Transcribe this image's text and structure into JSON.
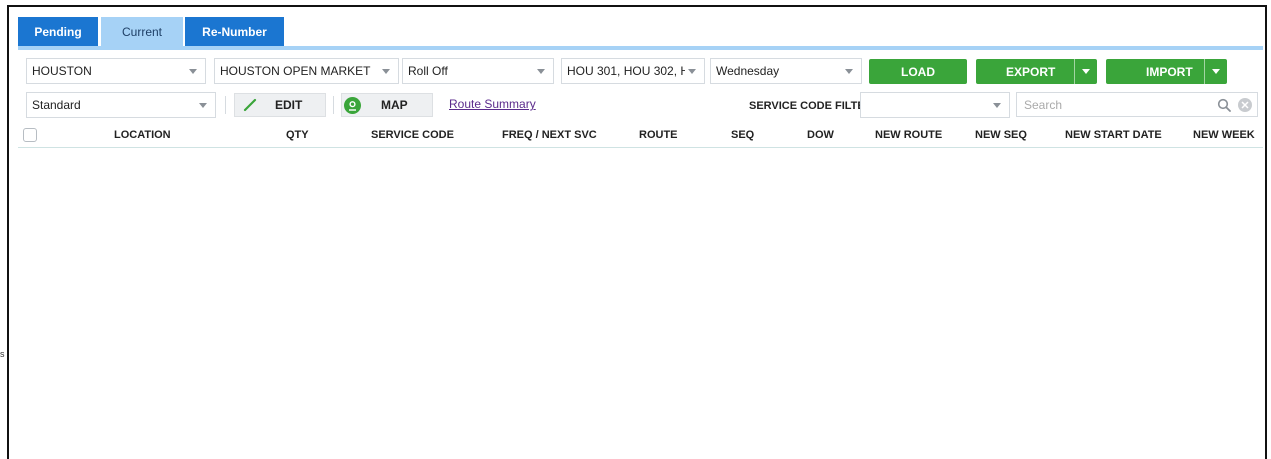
{
  "tabs": [
    {
      "label": "Pending",
      "active": false
    },
    {
      "label": "Current",
      "active": true
    },
    {
      "label": "Re-Number",
      "active": false
    }
  ],
  "filters": {
    "region": "HOUSTON",
    "market": "HOUSTON OPEN MARKET",
    "service_type": "Roll Off",
    "routes": "HOU 301, HOU 302, H",
    "day": "Wednesday"
  },
  "actions": {
    "load_label": "LOAD",
    "export_label": "EXPORT",
    "import_label": "IMPORT"
  },
  "toolbar": {
    "view_mode": "Standard",
    "edit_label": "EDIT",
    "map_label": "MAP",
    "route_summary_label": "Route Summary",
    "service_code_filter_label": "SERVICE CODE FILTER",
    "service_code_filter_value": "",
    "search_placeholder": "Search"
  },
  "table": {
    "columns": [
      "LOCATION",
      "QTY",
      "SERVICE CODE",
      "FREQ / NEXT SVC",
      "ROUTE",
      "SEQ",
      "DOW",
      "NEW ROUTE",
      "NEW SEQ",
      "NEW START DATE",
      "NEW WEEK"
    ],
    "rows": []
  },
  "edge_glyph": "s",
  "colors": {
    "tab_active_bg": "#a6d2f6",
    "tab_bg": "#1b76d1",
    "action_green": "#3aa53a",
    "link_purple": "#5b2b8c"
  }
}
